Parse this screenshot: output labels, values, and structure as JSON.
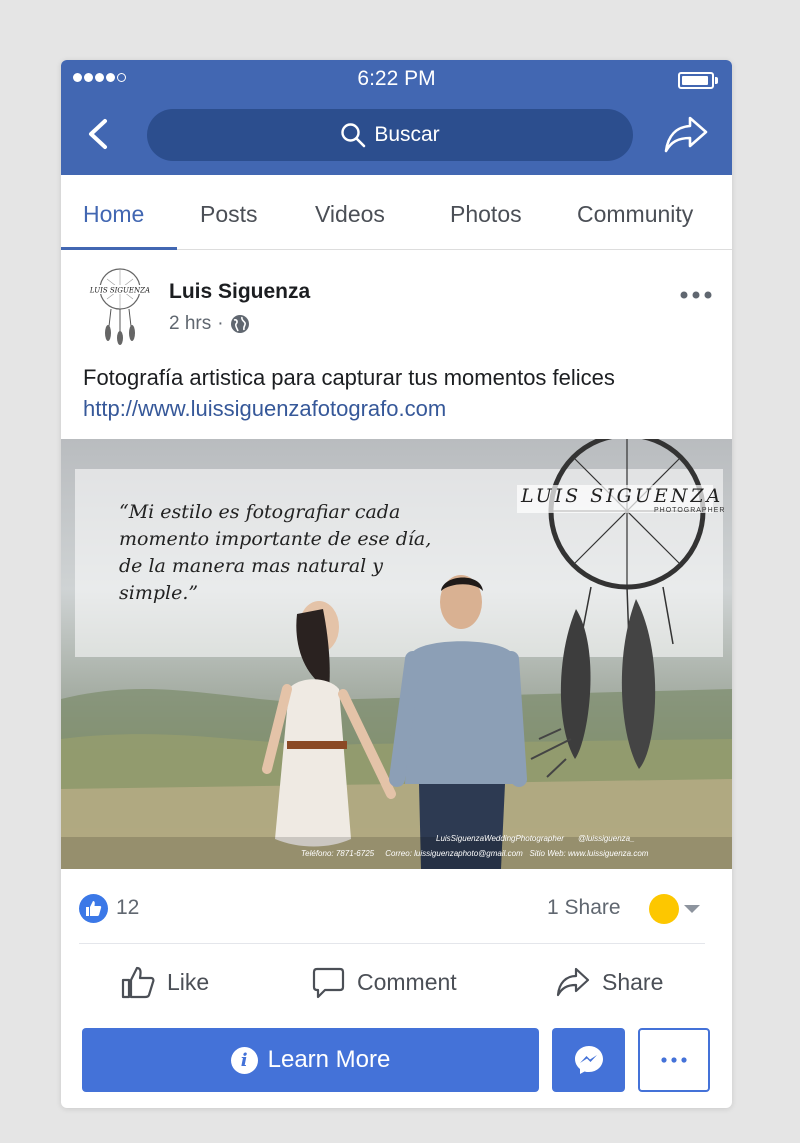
{
  "status_bar": {
    "time": "6:22 PM",
    "signal_bars": 4,
    "signal_total": 5,
    "battery_level": 0.8
  },
  "header": {
    "search_label": "Buscar",
    "icons": [
      "back-arrow-icon",
      "search-icon",
      "share-icon"
    ]
  },
  "tabs": [
    {
      "label": "Home",
      "active": true
    },
    {
      "label": "Posts",
      "active": false
    },
    {
      "label": "Videos",
      "active": false
    },
    {
      "label": "Photos",
      "active": false
    },
    {
      "label": "Community",
      "active": false
    }
  ],
  "post": {
    "author": "Luis Siguenza",
    "avatar_text": "LUIS SIGUENZA",
    "time": "2 hrs",
    "separator": "·",
    "audience_icon": "globe-icon",
    "text": "Fotografía artistica para capturar tus momentos felices",
    "link": "http://www.luissiguenzafotografo.com",
    "image": {
      "quote": "“Mi estilo es fotografiar cada momento importante de ese día, de la manera mas natural y simple.”",
      "brand": "LUIS SIGUENZA",
      "brand_sub": "PHOTOGRAPHER",
      "social_facebook": "LuisSiguenzaWeddingPhotographer",
      "social_instagram": "@luissiguenza_",
      "phone": "Teléfono: 7871-6725",
      "email": "Correo: luissiguenzaphoto@gmail.com",
      "website": "Sitio Web: www.luissiguenza.com"
    }
  },
  "reactions": {
    "like_count": "12",
    "shares": "1 Share",
    "reaction_color": "#fdc700"
  },
  "actions": {
    "like": "Like",
    "comment": "Comment",
    "share": "Share"
  },
  "cta": {
    "learn_more": "Learn More"
  },
  "colors": {
    "brand": "#4267b2",
    "button": "#4472d8",
    "link": "#365899"
  }
}
